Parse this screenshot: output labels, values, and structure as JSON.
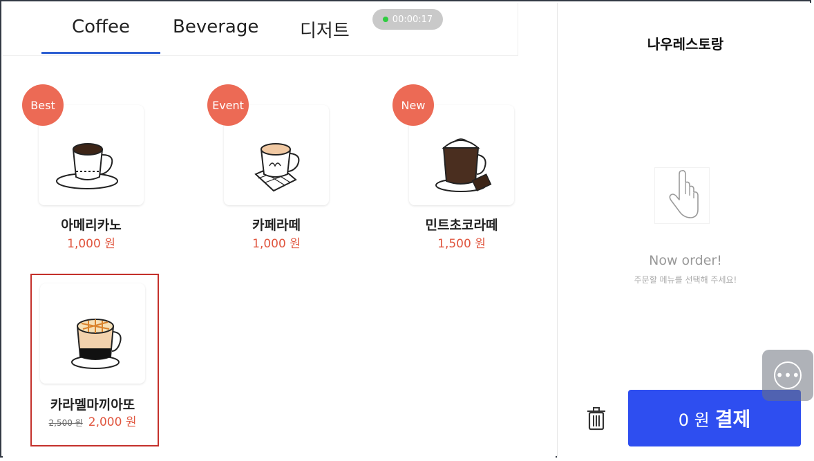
{
  "tabs": [
    {
      "label": "Coffee",
      "active": true
    },
    {
      "label": "Beverage",
      "active": false
    },
    {
      "label": "디저트",
      "active": false
    }
  ],
  "timer": "00:00:17",
  "products": [
    {
      "name": "아메리카노",
      "price": "1,000 원",
      "badge": "Best",
      "icon": "coffee-cup-icon"
    },
    {
      "name": "카페라떼",
      "price": "1,000 원",
      "badge": "Event",
      "icon": "latte-cup-icon"
    },
    {
      "name": "민트초코라떼",
      "price": "1,500 원",
      "badge": "New",
      "icon": "mint-choco-latte-icon"
    },
    {
      "name": "카라멜마끼아또",
      "old_price": "2,500 원",
      "price": "2,000 원",
      "badge": "",
      "icon": "caramel-macchiato-icon"
    }
  ],
  "cart": {
    "store_name": "나우레스토랑",
    "empty_title": "Now order!",
    "empty_hint": "주문할 메뉴를 선택해 주세요!",
    "total": "0 원",
    "pay_label": "결제"
  },
  "colors": {
    "accent": "#2e4ef0",
    "badge": "#ec6a55",
    "price": "#e0563f",
    "tab_underline": "#2d5fd2"
  }
}
